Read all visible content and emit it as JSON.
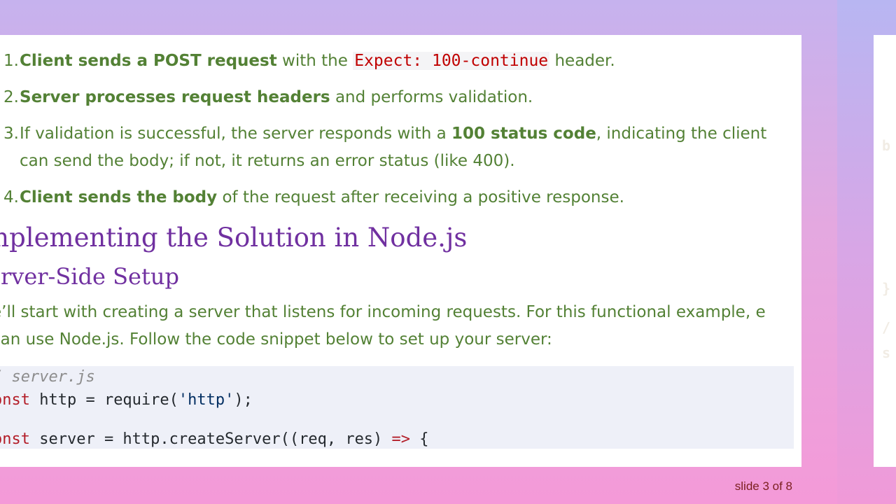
{
  "steps": [
    {
      "number": "1.",
      "bold": "Client sends a POST request",
      "text1": " with the ",
      "code": "Expect: 100-continue",
      "text2": " header."
    },
    {
      "number": "2.",
      "bold": "Server processes request headers",
      "text": " and performs validation."
    },
    {
      "number": "3.",
      "text1": "If validation is successful, the server responds with a ",
      "bold": "100 status code",
      "text2": ", indicating the client can send the body; if not, it returns an error status (like 400)."
    },
    {
      "number": "4.",
      "bold": "Client sends the body",
      "text": " of the request after receiving a positive response."
    }
  ],
  "heading2": "mplementing the Solution in Node.js",
  "heading3": "erver-Side Setup",
  "paragraph": "e’ll start with creating a server that listens for incoming requests. For this functional example, e can use Node.js. Follow the code snippet below to set up your server:",
  "code": {
    "line1_comment": "/ server.js",
    "line2_kw": "onst",
    "line2_mid": " http = require(",
    "line2_str": "'http'",
    "line2_end": ");",
    "line3_kw": "onst",
    "line3_mid": " server = http.createServer((req, res) ",
    "line3_arrow": "=>",
    "line3_end": " {"
  },
  "next_slide_ghost": [
    "b",
    "}",
    "/",
    "s"
  ],
  "footer": "slide 3 of 8"
}
